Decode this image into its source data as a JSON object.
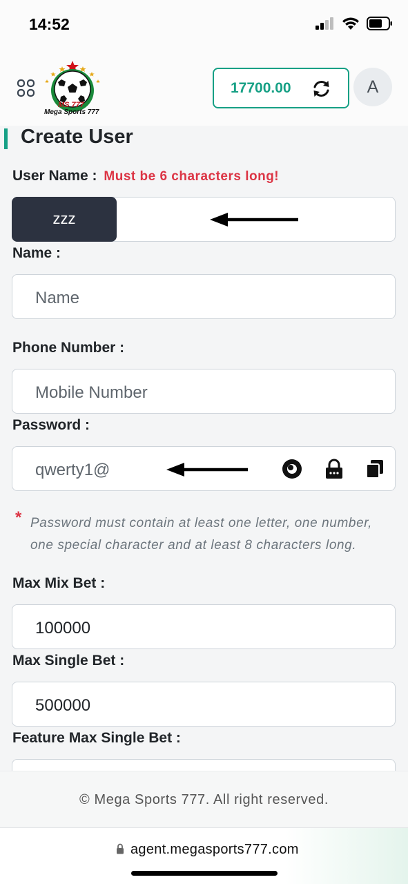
{
  "status_bar": {
    "time": "14:52"
  },
  "header": {
    "logo_text": "MS 777",
    "logo_subtext": "Mega Sports 777",
    "balance": "17700.00",
    "avatar_initial": "A"
  },
  "form": {
    "title": "Create User",
    "username": {
      "label": "User Name :",
      "warning": "Must be 6 characters long!",
      "prefix_value": "zzz"
    },
    "name": {
      "label": "Name :",
      "placeholder": "Name"
    },
    "phone": {
      "label": "Phone Number :",
      "placeholder": "Mobile Number"
    },
    "password": {
      "label": "Password :",
      "value": "qwerty1@"
    },
    "password_hint": {
      "star": "*",
      "line1": "Password must contain at least one letter, one number,",
      "line2": "one special character and at least 8 characters long."
    },
    "max_mix_bet": {
      "label": "Max Mix Bet :",
      "value": "100000"
    },
    "max_single_bet": {
      "label": "Max Single Bet :",
      "value": "500000"
    },
    "feature_max_single_bet": {
      "label": "Feature Max Single Bet :"
    }
  },
  "footer": {
    "copyright": "© Mega Sports 777. All right reserved."
  },
  "browser": {
    "url": "agent.megasports777.com"
  },
  "colors": {
    "accent": "#16a085",
    "warning": "#dc3545",
    "prefix_bg": "#2c3240"
  }
}
